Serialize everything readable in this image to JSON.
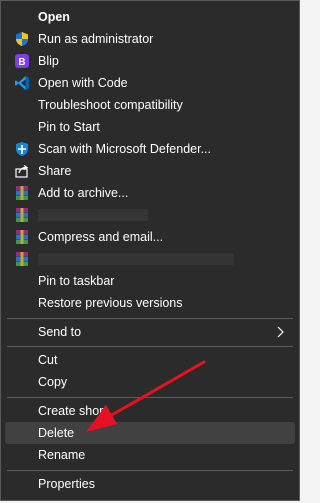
{
  "menu": {
    "items": {
      "open": "Open",
      "run_as_admin": "Run as administrator",
      "blip": "Blip",
      "open_with_code": "Open with Code",
      "troubleshoot": "Troubleshoot compatibility",
      "pin_to_start": "Pin to Start",
      "scan_defender": "Scan with Microsoft Defender...",
      "share": "Share",
      "add_to_archive": "Add to archive...",
      "compress_email": "Compress and email...",
      "pin_to_taskbar": "Pin to taskbar",
      "restore_versions": "Restore previous versions",
      "send_to": "Send to",
      "cut": "Cut",
      "copy": "Copy",
      "create_shortcut": "Create short",
      "delete": "Delete",
      "rename": "Rename",
      "properties": "Properties"
    },
    "hovered_item": "delete",
    "annotation_color": "#e81123"
  },
  "icons": {
    "run_as_admin": "uac-shield-icon",
    "blip": "blip-icon",
    "open_with_code": "vscode-icon",
    "scan_defender": "defender-shield-icon",
    "share": "share-icon",
    "archive": "winrar-icon",
    "send_to": "chevron-right-icon"
  }
}
